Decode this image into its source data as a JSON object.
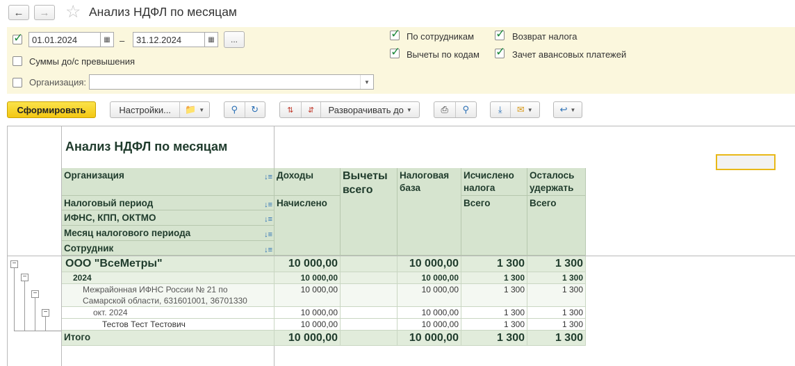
{
  "window": {
    "title": "Анализ НДФЛ по месяцам",
    "back_icon": "arrow-left-icon",
    "forward_icon": "arrow-right-icon",
    "favorite_icon": "star-icon"
  },
  "filters": {
    "period_enabled": true,
    "date_from": "01.01.2024",
    "date_dash": "–",
    "date_to": "31.12.2024",
    "period_button": "...",
    "sums_before_excess": {
      "label": "Суммы до/с превышения",
      "checked": false
    },
    "organization": {
      "label": "Организация:",
      "value": "",
      "checked": false
    },
    "by_employees": {
      "label": "По сотрудникам",
      "checked": true
    },
    "deductions_by_codes": {
      "label": "Вычеты по кодам",
      "checked": true
    },
    "tax_return": {
      "label": "Возврат налога",
      "checked": true
    },
    "advance_offset": {
      "label": "Зачет авансовых платежей",
      "checked": true
    }
  },
  "toolbar": {
    "generate": "Сформировать",
    "settings": "Настройки...",
    "expand_to": "Разворачивать до"
  },
  "report": {
    "title": "Анализ НДФЛ по месяцам",
    "groupings": [
      "Организация",
      "Налоговый период",
      "ИФНС, КПП, ОКТМО",
      "Месяц налогового периода",
      "Сотрудник"
    ],
    "columns": {
      "income": "Доходы",
      "income_sub": "Начислено",
      "deductions": "Вычеты всего",
      "tax_base": "Налоговая база",
      "calculated": "Исчислено налога",
      "calculated_sub": "Всего",
      "remaining": "Осталось удержать",
      "remaining_sub": "Всего"
    },
    "rows": [
      {
        "name": "ООО \"ВсеМетры\"",
        "income": "10 000,00",
        "deductions": "",
        "base": "10 000,00",
        "calc": "1 300",
        "remain": "1 300"
      },
      {
        "name": "2024",
        "income": "10 000,00",
        "deductions": "",
        "base": "10 000,00",
        "calc": "1 300",
        "remain": "1 300"
      },
      {
        "name_line1": "Межрайонная ИФНС России № 21 по",
        "name_line2": "Самарской области, 631601001, 36701330",
        "income": "10 000,00",
        "deductions": "",
        "base": "10 000,00",
        "calc": "1 300",
        "remain": "1 300"
      },
      {
        "name": "окт. 2024",
        "income": "10 000,00",
        "deductions": "",
        "base": "10 000,00",
        "calc": "1 300",
        "remain": "1 300"
      },
      {
        "name": "Тестов Тест Тестович",
        "income": "10 000,00",
        "deductions": "",
        "base": "10 000,00",
        "calc": "1 300",
        "remain": "1 300"
      }
    ],
    "total": {
      "label": "Итого",
      "income": "10 000,00",
      "deductions": "",
      "base": "10 000,00",
      "calc": "1 300",
      "remain": "1 300"
    }
  }
}
